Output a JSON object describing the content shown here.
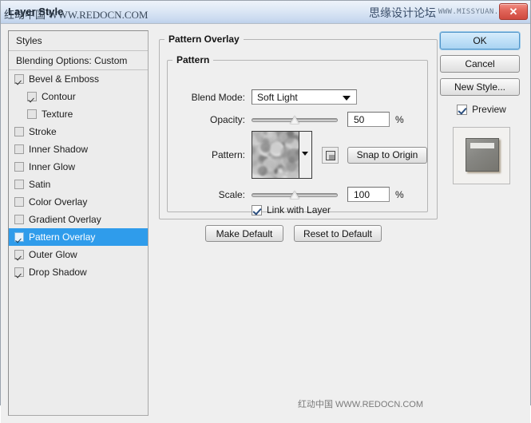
{
  "window": {
    "title": "Layer Style",
    "watermark_left": "红动中国 WWW.REDOCN.COM",
    "watermark_title_cn": "思缘设计论坛",
    "watermark_title_url": "WWW.MISSYUAN.COM",
    "close_glyph": "✕"
  },
  "sidebar": {
    "header": "Styles",
    "blending_options": "Blending Options: Custom",
    "items": [
      {
        "label": "Bevel & Emboss",
        "checked": true,
        "indent": false,
        "selected": false
      },
      {
        "label": "Contour",
        "checked": true,
        "indent": true,
        "selected": false
      },
      {
        "label": "Texture",
        "checked": false,
        "indent": true,
        "selected": false
      },
      {
        "label": "Stroke",
        "checked": false,
        "indent": false,
        "selected": false
      },
      {
        "label": "Inner Shadow",
        "checked": false,
        "indent": false,
        "selected": false
      },
      {
        "label": "Inner Glow",
        "checked": false,
        "indent": false,
        "selected": false
      },
      {
        "label": "Satin",
        "checked": false,
        "indent": false,
        "selected": false
      },
      {
        "label": "Color Overlay",
        "checked": false,
        "indent": false,
        "selected": false
      },
      {
        "label": "Gradient Overlay",
        "checked": false,
        "indent": false,
        "selected": false
      },
      {
        "label": "Pattern Overlay",
        "checked": true,
        "indent": false,
        "selected": true
      },
      {
        "label": "Outer Glow",
        "checked": true,
        "indent": false,
        "selected": false
      },
      {
        "label": "Drop Shadow",
        "checked": true,
        "indent": false,
        "selected": false
      }
    ]
  },
  "panel": {
    "group_title": "Pattern Overlay",
    "subgroup_title": "Pattern",
    "blend_mode": {
      "label": "Blend Mode:",
      "value": "Soft Light"
    },
    "opacity": {
      "label": "Opacity:",
      "value": "50",
      "unit": "%",
      "percent": 50
    },
    "pattern": {
      "label": "Pattern:",
      "snap_to_origin": "Snap to Origin"
    },
    "scale": {
      "label": "Scale:",
      "value": "100",
      "unit": "%",
      "percent": 50
    },
    "link_with_layer": {
      "label": "Link with Layer",
      "checked": true
    },
    "make_default": "Make Default",
    "reset_to_default": "Reset to Default"
  },
  "actions": {
    "ok": "OK",
    "cancel": "Cancel",
    "new_style": "New Style...",
    "preview": {
      "label": "Preview",
      "checked": true
    }
  },
  "colors": {
    "selection_blue": "#2f9ceb",
    "titlebar_blue": "#c9d9ef",
    "dialog_bg": "#efefef",
    "close_red": "#cf4a3f"
  }
}
